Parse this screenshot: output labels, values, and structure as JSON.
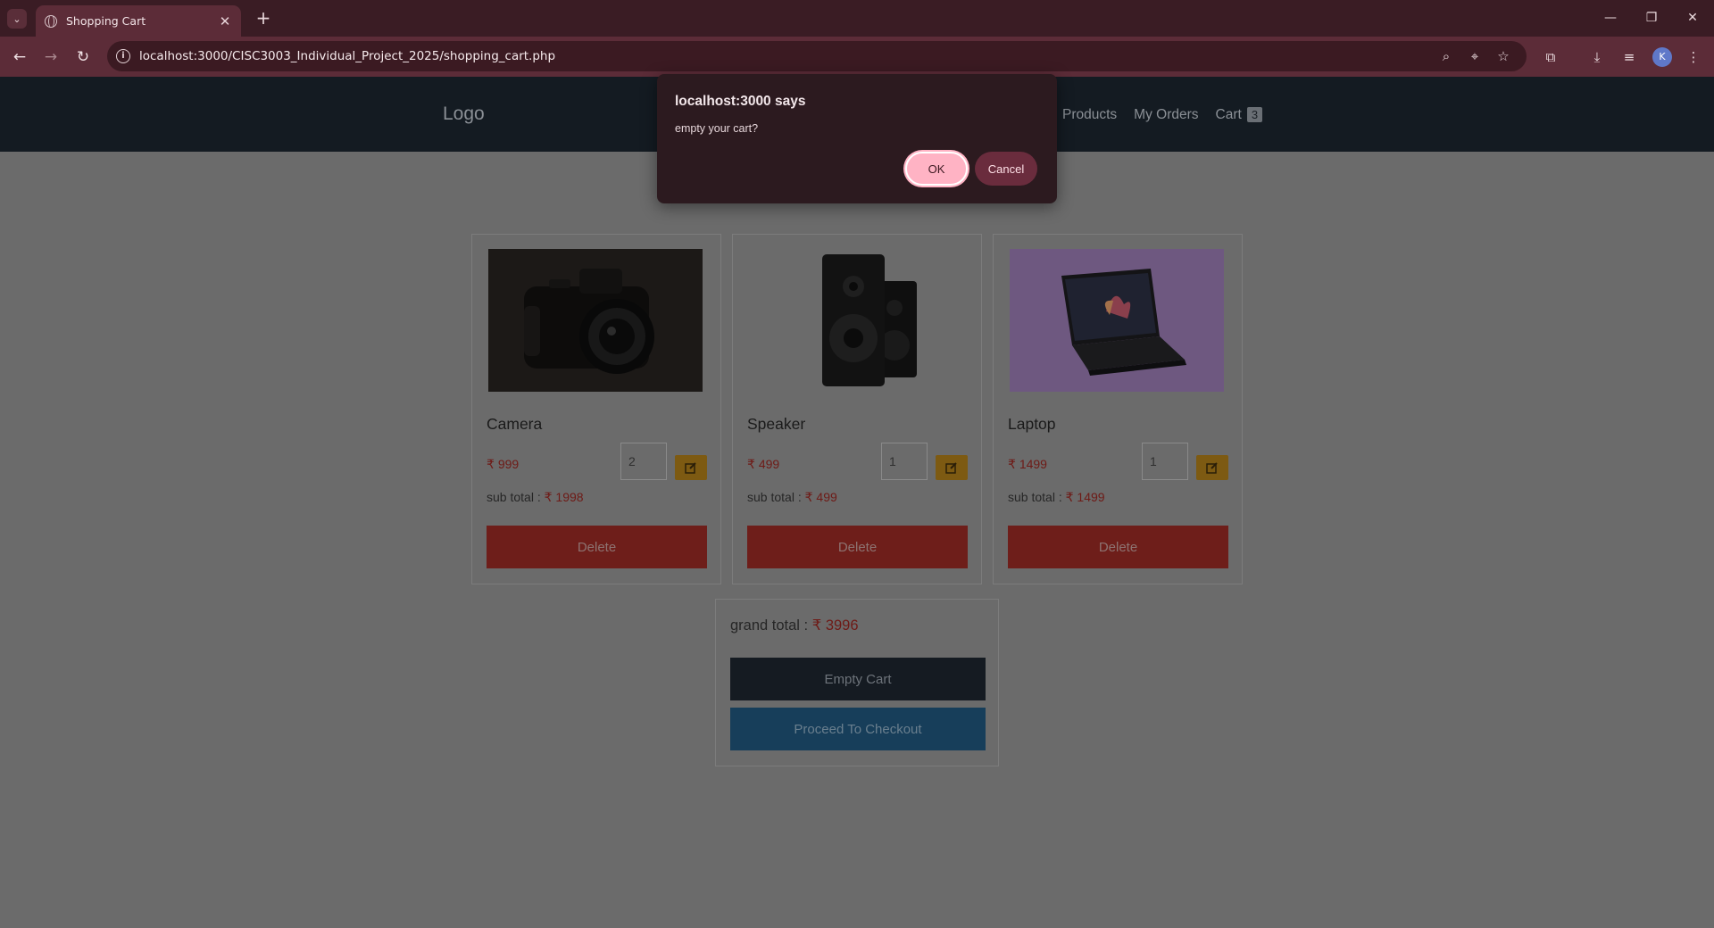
{
  "browser": {
    "tab_title": "Shopping Cart",
    "tab_close": "✕",
    "new_tab": "+",
    "url": "localhost:3000/CISC3003_Individual_Project_2025/shopping_cart.php",
    "profile_initial": "K",
    "icons": [
      "tab-search-icon",
      "globe-icon",
      "back-icon",
      "forward-icon",
      "reload-icon",
      "site-info-icon",
      "zoom-icon",
      "location-icon",
      "bookmark-star-icon",
      "extensions-icon",
      "download-icon",
      "media-icon",
      "menu-icon"
    ]
  },
  "header": {
    "logo": "Logo",
    "nav": {
      "products": "Products",
      "orders": "My Orders",
      "cart": "Cart",
      "cart_count": "3"
    }
  },
  "cart": {
    "currency_symbol": "₹",
    "items": [
      {
        "name": "Camera",
        "price": "999",
        "qty": "2",
        "subtotal_label": "sub total :",
        "subtotal": "1998",
        "delete": "Delete"
      },
      {
        "name": "Speaker",
        "price": "499",
        "qty": "1",
        "subtotal_label": "sub total :",
        "subtotal": "499",
        "delete": "Delete"
      },
      {
        "name": "Laptop",
        "price": "1499",
        "qty": "1",
        "subtotal_label": "sub total :",
        "subtotal": "1499",
        "delete": "Delete"
      }
    ],
    "grand_total_label": "grand total :",
    "grand_total": "3996",
    "empty_cart": "Empty Cart",
    "checkout": "Proceed To Checkout"
  },
  "dialog": {
    "title": "localhost:3000 says",
    "message": "empty your cart?",
    "ok": "OK",
    "cancel": "Cancel"
  },
  "colors": {
    "dialog_ok": "#ffb3c4",
    "dialog_cancel": "#6a2c3d",
    "delete": "#6e1e1a",
    "checkout": "#173e5a",
    "edit": "#7d5a12"
  }
}
